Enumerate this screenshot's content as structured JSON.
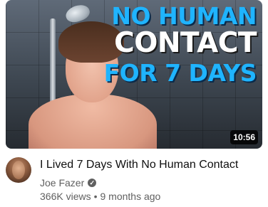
{
  "video": {
    "thumbnail": {
      "line1": "NO HUMAN",
      "line2": "CONTACT",
      "line3": "FOR 7 DAYS",
      "duration": "10:56",
      "accent_color": "#1fb4ff"
    },
    "title": "I Lived 7 Days With No Human Contact",
    "channel": "Joe Fazer",
    "verified_icon": "check-circle-icon",
    "views": "366K views",
    "separator": "•",
    "age": "9 months ago"
  }
}
